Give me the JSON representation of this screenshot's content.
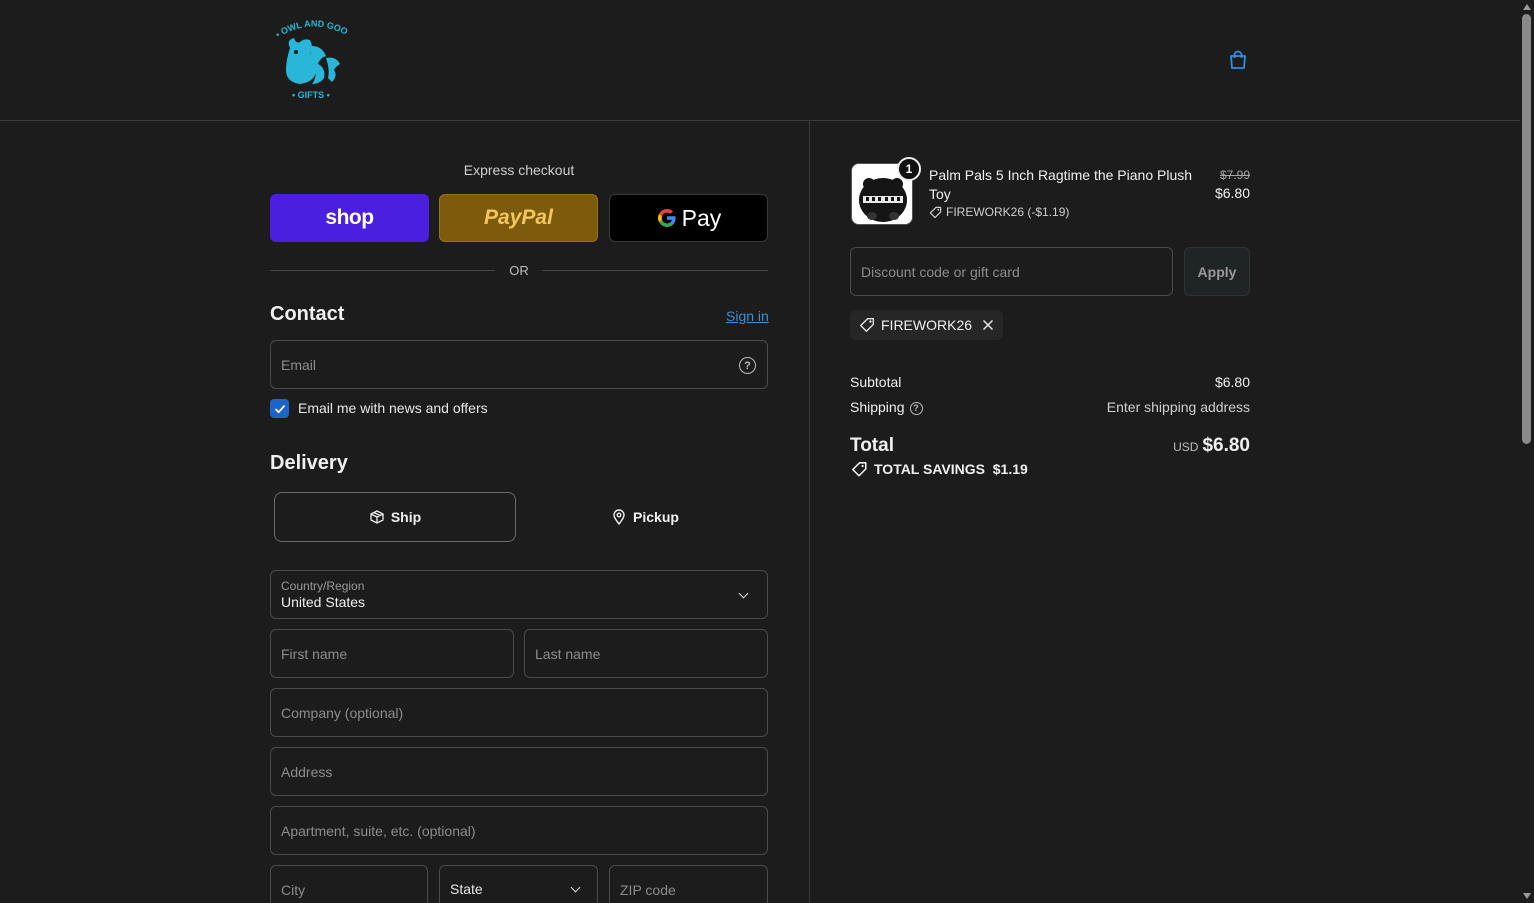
{
  "header": {
    "logo_alt": "Owl and Goose Gifts",
    "cart_icon": "shopping-bag-icon"
  },
  "express": {
    "title": "Express checkout",
    "shop_label": "shop",
    "paypal_label": "PayPal",
    "gpay_label": "Pay",
    "or": "OR"
  },
  "contact": {
    "heading": "Contact",
    "signin": "Sign in",
    "email_placeholder": "Email",
    "newsletter_label": "Email me with news and offers",
    "newsletter_checked": true
  },
  "delivery": {
    "heading": "Delivery",
    "options": [
      {
        "label": "Ship",
        "selected": true
      },
      {
        "label": "Pickup",
        "selected": false
      }
    ],
    "country_label": "Country/Region",
    "country_value": "United States",
    "first_name_placeholder": "First name",
    "last_name_placeholder": "Last name",
    "company_placeholder": "Company (optional)",
    "address_placeholder": "Address",
    "apartment_placeholder": "Apartment, suite, etc. (optional)",
    "city_placeholder": "City",
    "state_label": "State",
    "zip_placeholder": "ZIP code"
  },
  "order": {
    "item": {
      "quantity": "1",
      "name": "Palm Pals 5 Inch Ragtime the Piano Plush Toy",
      "discount": "FIREWORK26 (-$1.19)",
      "original_price": "$7.99",
      "price": "$6.80"
    },
    "discount_placeholder": "Discount code or gift card",
    "apply_label": "Apply",
    "applied_code": "FIREWORK26",
    "subtotal_label": "Subtotal",
    "subtotal_value": "$6.80",
    "shipping_label": "Shipping",
    "shipping_value": "Enter shipping address",
    "total_label": "Total",
    "currency": "USD",
    "total_value": "$6.80",
    "savings": "TOTAL SAVINGS  $1.19"
  },
  "colors": {
    "background": "#1c1c1c",
    "accent_blue": "#1e64c8",
    "link_blue": "#3f8fd6",
    "shop_purple": "#4b1fe0",
    "paypal_gold": "#7e5b0c",
    "logo_cyan": "#29b6d8"
  }
}
